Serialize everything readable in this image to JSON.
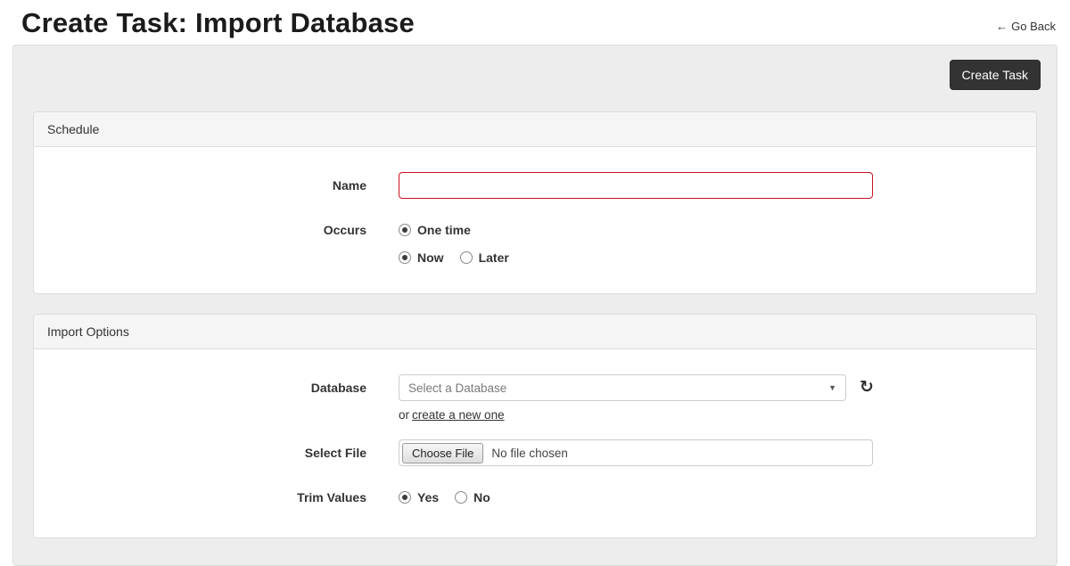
{
  "page": {
    "title": "Create Task: Import Database",
    "go_back_label": "Go Back"
  },
  "icons": {
    "left_arrow": "←",
    "chevron_down": "▼",
    "refresh": "↻"
  },
  "toolbar": {
    "create_task_label": "Create Task"
  },
  "schedule": {
    "header": "Schedule",
    "name": {
      "label": "Name",
      "value": ""
    },
    "occurs": {
      "label": "Occurs",
      "options": [
        {
          "label": "One time",
          "selected": true
        }
      ],
      "time_options": [
        {
          "label": "Now",
          "selected": true
        },
        {
          "label": "Later",
          "selected": false
        }
      ]
    }
  },
  "import_options": {
    "header": "Import Options",
    "database": {
      "label": "Database",
      "selected_value": "Select a Database",
      "create_new_prefix": "or",
      "create_new_link": "create a new one"
    },
    "select_file": {
      "label": "Select File",
      "button_label": "Choose File",
      "status_text": "No file chosen"
    },
    "trim_values": {
      "label": "Trim Values",
      "options": [
        {
          "label": "Yes",
          "selected": true
        },
        {
          "label": "No",
          "selected": false
        }
      ]
    }
  }
}
